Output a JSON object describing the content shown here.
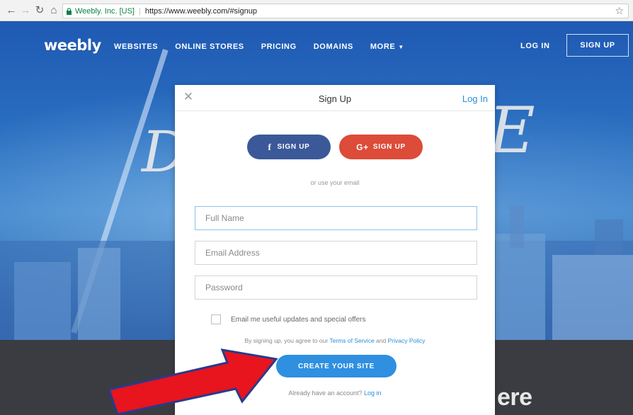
{
  "browser": {
    "secure_label": "Weebly. Inc. [US]",
    "url": "https://www.weebly.com/#signup",
    "back_icon": "back-arrow-icon",
    "forward_icon": "forward-arrow-icon",
    "reload_icon": "reload-icon",
    "home_icon": "home-icon",
    "bookmark_icon": "star-icon"
  },
  "site_nav": {
    "logo": "weebly",
    "links": [
      "WEBSITES",
      "ONLINE STORES",
      "PRICING",
      "DOMAINS",
      "MORE"
    ],
    "login": "LOG IN",
    "signup": "SIGN UP"
  },
  "background": {
    "partial_text": "ere"
  },
  "modal": {
    "title": "Sign Up",
    "login_link": "Log In",
    "facebook_button": "SIGN UP",
    "google_button": "SIGN UP",
    "google_icon_text": "G+",
    "facebook_icon_text": "f",
    "or_text": "or use your email",
    "fields": {
      "full_name_placeholder": "Full Name",
      "email_placeholder": "Email Address",
      "password_placeholder": "Password"
    },
    "updates_label": "Email me useful updates and special offers",
    "terms_prefix": "By signing up, you agree to our",
    "terms_of_service": "Terms of Service",
    "terms_and": "and",
    "privacy_policy": "Privacy Policy",
    "create_button": "CREATE YOUR SITE",
    "already_text": "Already have an account?",
    "already_login": "Log in"
  },
  "colors": {
    "facebook": "#3b5998",
    "google": "#dd4b39",
    "primary": "#2f8fe0",
    "link": "#2a8fd8",
    "arrow": "#e8141e"
  }
}
